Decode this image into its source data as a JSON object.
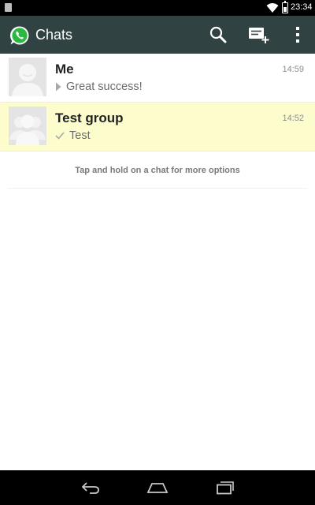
{
  "status_bar": {
    "time": "23:34"
  },
  "action_bar": {
    "title": "Chats",
    "icons": [
      "whatsapp-logo",
      "search-icon",
      "new-chat-icon",
      "overflow-menu-icon"
    ]
  },
  "chats": [
    {
      "name": "Me",
      "time": "14:59",
      "preview": "Great success!",
      "preview_icon": "play-triangle-icon",
      "avatar": "person-placeholder",
      "selected": false
    },
    {
      "name": "Test group",
      "time": "14:52",
      "preview": "Test",
      "preview_icon": "check-icon",
      "avatar": "group-placeholder",
      "selected": true
    }
  ],
  "hint": "Tap and hold on a chat for more options",
  "colors": {
    "action_bar": "#304342",
    "selected_row": "#fdfccd",
    "whatsapp_green": "#2bb741"
  }
}
